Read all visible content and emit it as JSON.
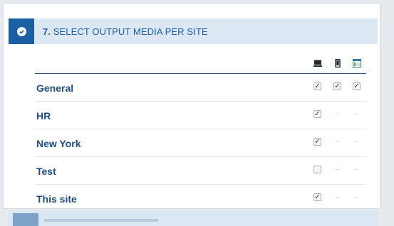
{
  "step": {
    "number": "7.",
    "title": "SELECT OUTPUT MEDIA PER SITE",
    "status_icon": "check-circle-icon"
  },
  "media_columns": [
    {
      "icon": "desktop-icon"
    },
    {
      "icon": "mobile-icon"
    },
    {
      "icon": "web-page-icon"
    }
  ],
  "sites": [
    {
      "name": "General",
      "desktop": "checked",
      "mobile": "checked",
      "web": "checked"
    },
    {
      "name": "HR",
      "desktop": "checked",
      "mobile": "disabled",
      "web": "disabled"
    },
    {
      "name": "New York",
      "desktop": "checked",
      "mobile": "disabled",
      "web": "disabled"
    },
    {
      "name": "Test",
      "desktop": "unchecked",
      "mobile": "disabled",
      "web": "disabled"
    },
    {
      "name": "This site",
      "desktop": "checked",
      "mobile": "disabled",
      "web": "disabled"
    }
  ],
  "disabled_glyph": "–",
  "colors": {
    "accent": "#1b5fa5",
    "header_bg": "#dbe7f3",
    "label": "#1f4e85"
  }
}
